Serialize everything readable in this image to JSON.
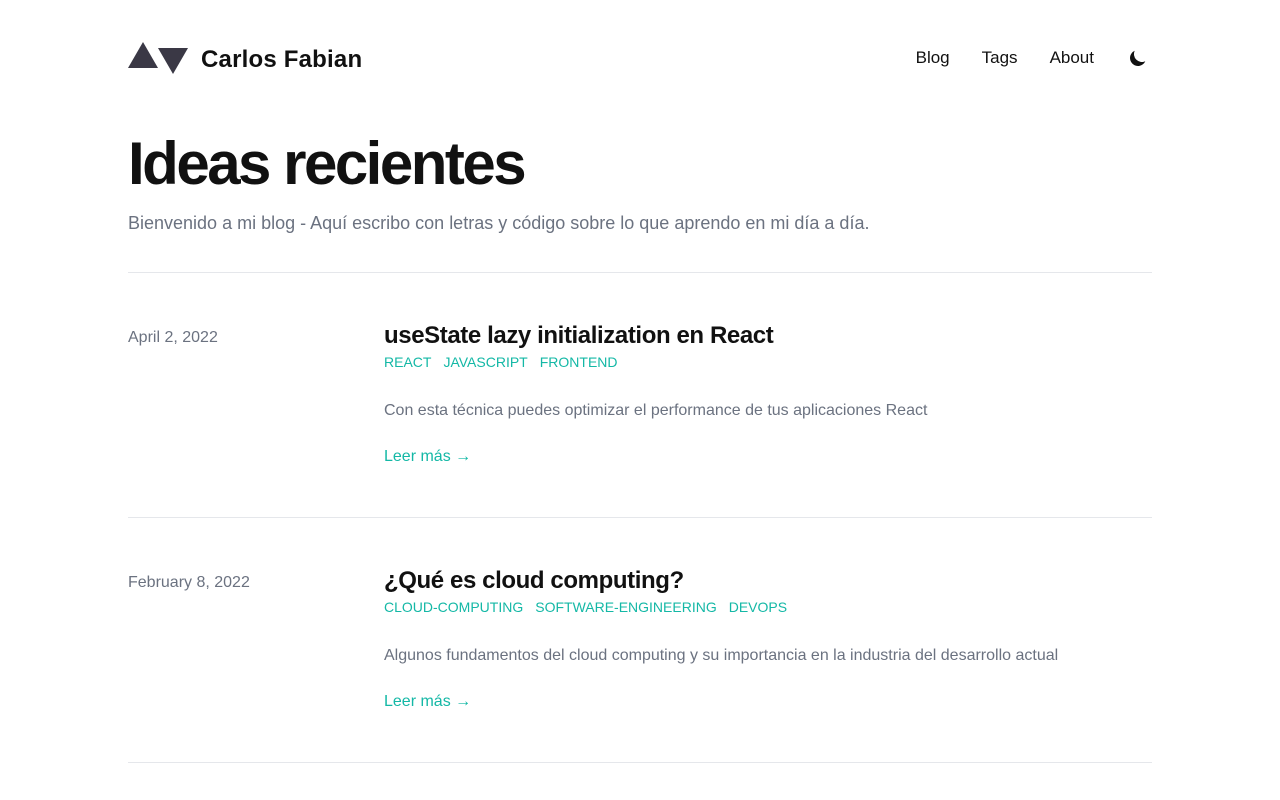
{
  "header": {
    "site_name": "Carlos Fabian",
    "nav": [
      {
        "label": "Blog"
      },
      {
        "label": "Tags"
      },
      {
        "label": "About"
      }
    ],
    "theme_icon": "moon-icon"
  },
  "hero": {
    "title": "Ideas recientes",
    "subtitle": "Bienvenido a mi blog - Aquí escribo con letras y código sobre lo que aprendo en mi día a día."
  },
  "posts": [
    {
      "date": "April 2, 2022",
      "title": "useState lazy initialization en React",
      "tags": [
        "REACT",
        "JAVASCRIPT",
        "FRONTEND"
      ],
      "excerpt": "Con esta técnica puedes optimizar el performance de tus aplicaciones React",
      "read_more": "Leer más →"
    },
    {
      "date": "February 8, 2022",
      "title": "¿Qué es cloud computing?",
      "tags": [
        "CLOUD-COMPUTING",
        "SOFTWARE-ENGINEERING",
        "DEVOPS"
      ],
      "excerpt": "Algunos fundamentos del cloud computing y su importancia en la industria del desarrollo actual",
      "read_more": "Leer más →"
    }
  ],
  "colors": {
    "accent": "#14b8a6",
    "text": "#111111",
    "muted": "#6b7280",
    "logo": "#3a3845",
    "divider": "#e5e7eb"
  }
}
